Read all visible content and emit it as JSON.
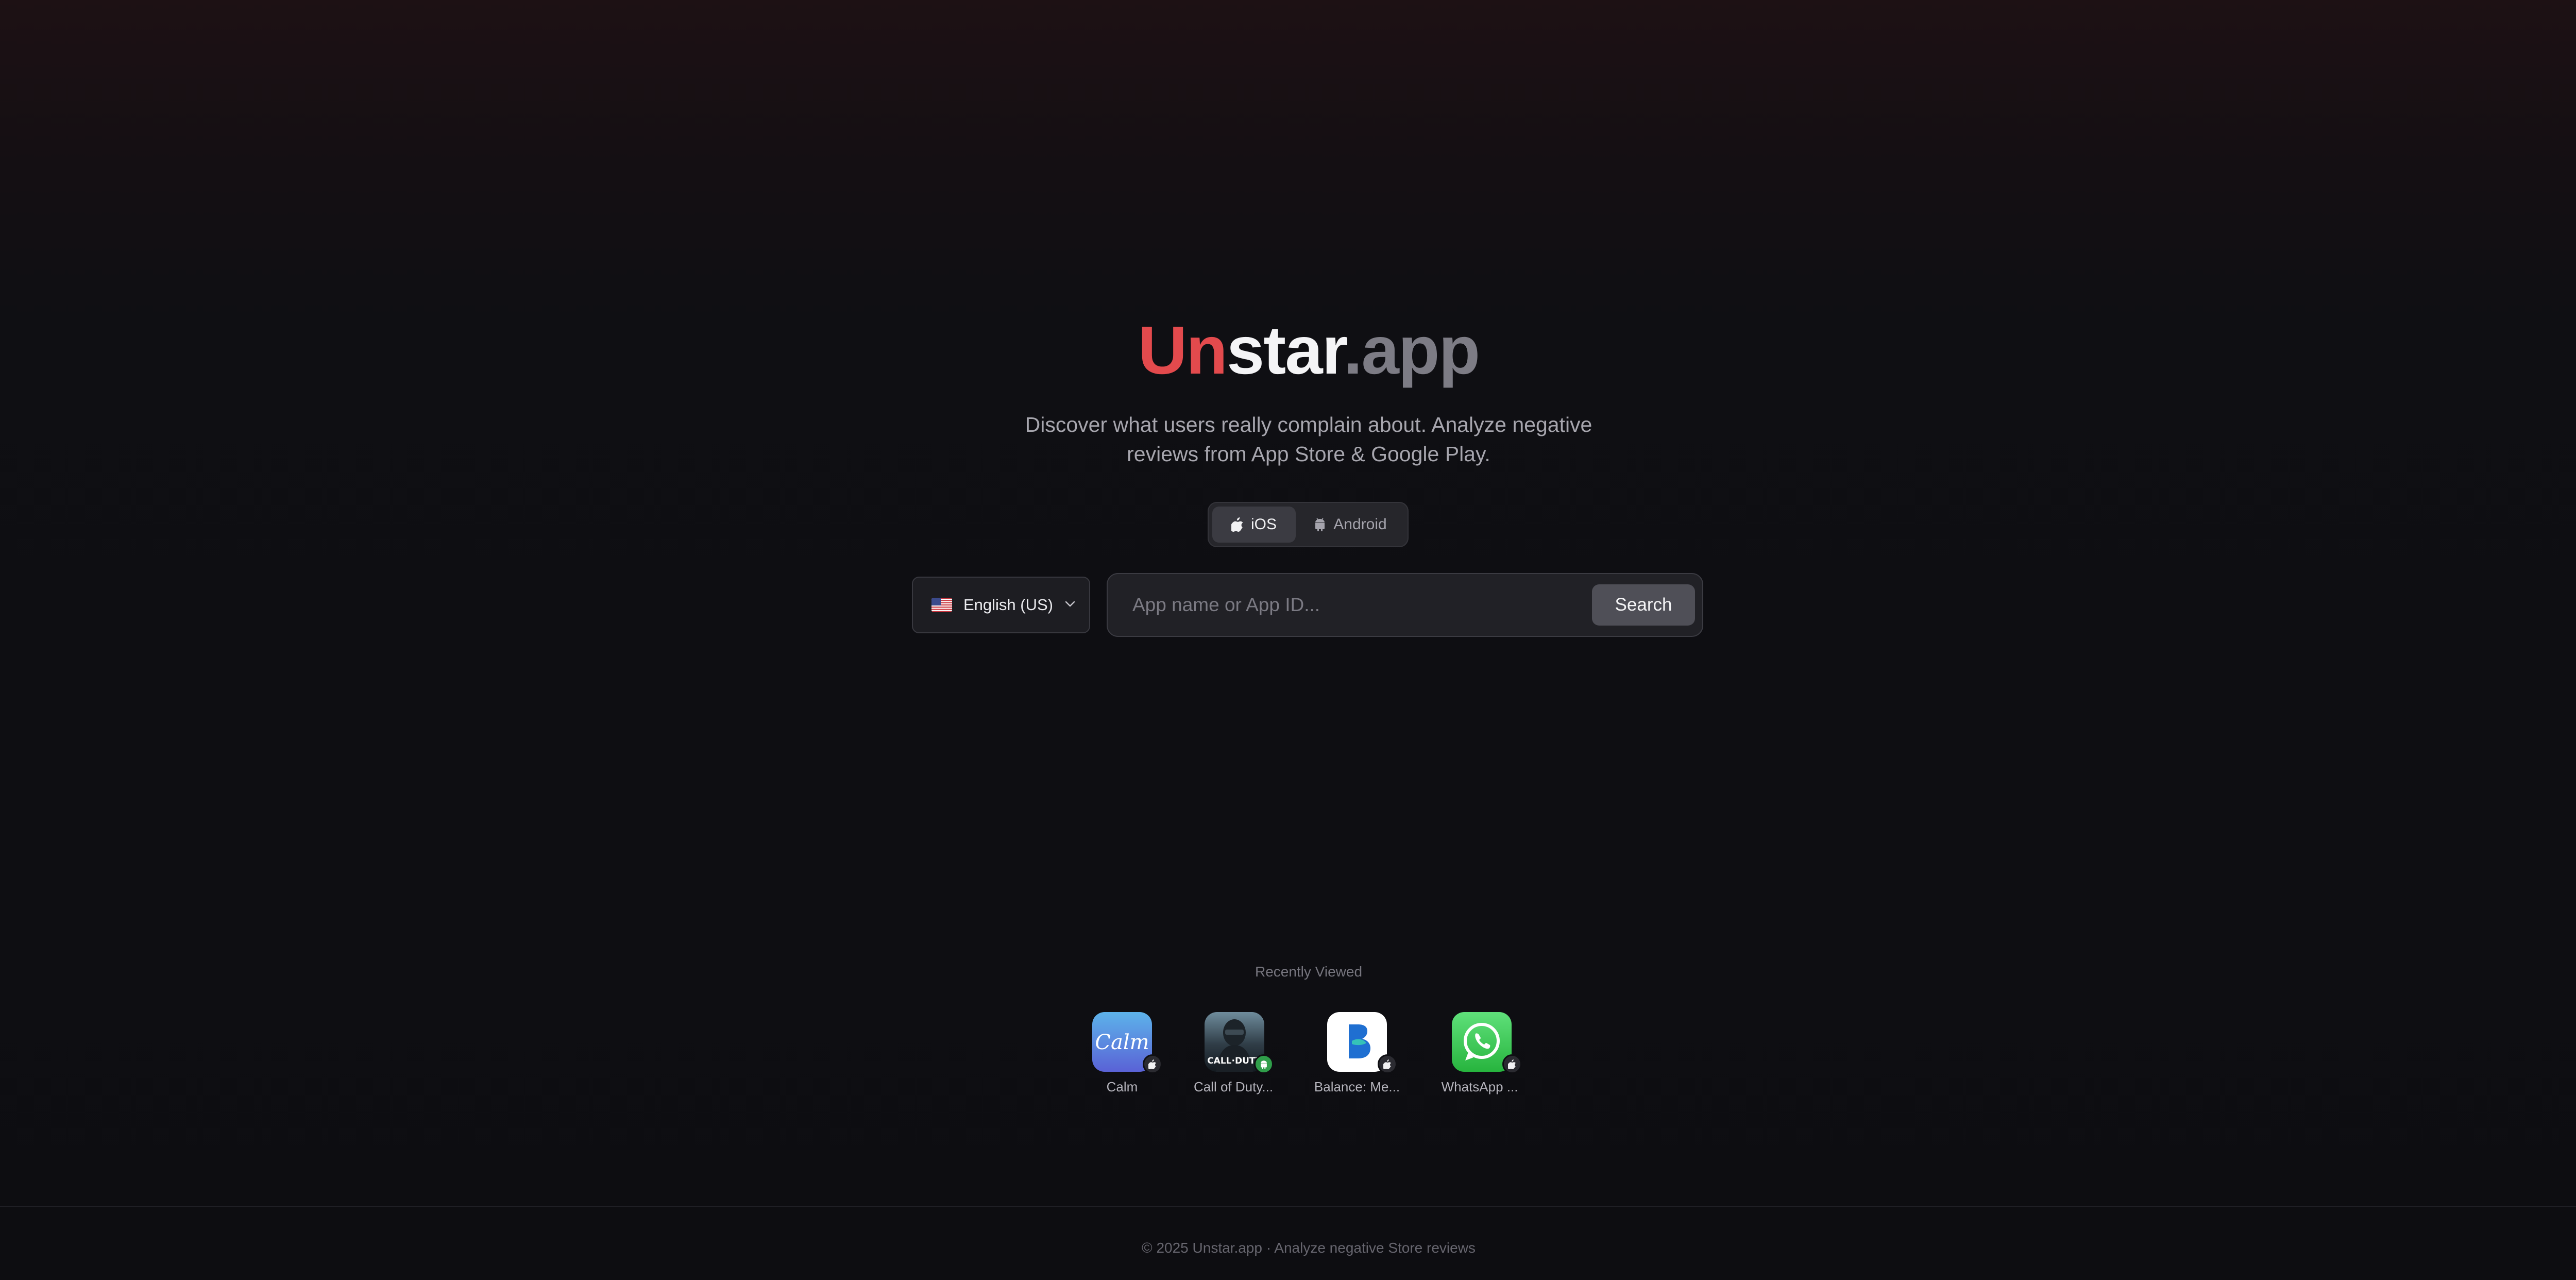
{
  "logo": {
    "part1": "Un",
    "part2": "star",
    "part3": ".app",
    "colors": {
      "part1": "#e34a4d",
      "part2": "#f4f4f6",
      "part3": "#7d7c85"
    }
  },
  "subtitle": {
    "line1": "Discover what users really complain about. Analyze negative",
    "line2": "reviews from App Store & Google Play."
  },
  "platform_toggle": {
    "selected": "iOS",
    "options": [
      {
        "label": "iOS",
        "icon": "apple-icon"
      },
      {
        "label": "Android",
        "icon": "android-icon"
      }
    ]
  },
  "language": {
    "selected_label": "English (US)",
    "flag_icon": "us-flag-icon"
  },
  "search": {
    "placeholder": "App name or App ID...",
    "value": "",
    "button_label": "Search"
  },
  "recently_viewed": {
    "heading": "Recently Viewed",
    "items": [
      {
        "name": "Calm",
        "platform": "ios",
        "icon": "calm-app-icon",
        "icon_text": "Calm"
      },
      {
        "name": "Call of Duty...",
        "platform": "android",
        "icon": "call-of-duty-app-icon",
        "icon_text": "CALL·DUTY"
      },
      {
        "name": "Balance: Me...",
        "platform": "ios",
        "icon": "balance-app-icon"
      },
      {
        "name": "WhatsApp ...",
        "platform": "ios",
        "icon": "whatsapp-app-icon"
      }
    ]
  },
  "footer": {
    "text": "© 2025 Unstar.app · Analyze negative Store reviews"
  }
}
